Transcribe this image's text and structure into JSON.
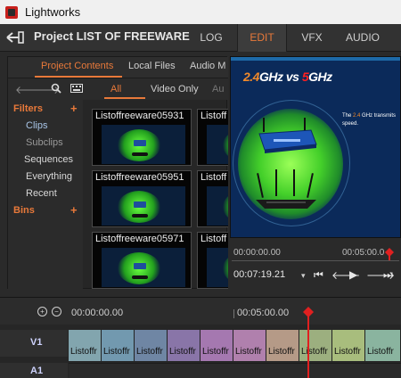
{
  "window": {
    "title": "Lightworks"
  },
  "topbar": {
    "project_title": "Project LIST OF FREEWARE",
    "caret": "▾",
    "tabs": [
      {
        "label": "LOG"
      },
      {
        "label": "EDIT",
        "active": true
      },
      {
        "label": "VFX"
      },
      {
        "label": "AUDIO"
      }
    ]
  },
  "content_panel": {
    "tabs": [
      {
        "label": "Project Contents",
        "active": true
      },
      {
        "label": "Local Files"
      },
      {
        "label": "Audio M"
      }
    ],
    "filter_tabs": [
      {
        "label": "All",
        "active": true
      },
      {
        "label": "Video Only"
      },
      {
        "label": "Au"
      }
    ],
    "filters_heading": "Filters",
    "filters": [
      "Clips",
      "Subclips",
      "Sequences",
      "Everything",
      "Recent"
    ],
    "bins_heading": "Bins",
    "plus": "+",
    "clips": [
      {
        "name": "Listoffreeware05931"
      },
      {
        "name": "Listoff"
      },
      {
        "name": "Listoffreeware05951"
      },
      {
        "name": "Listoff"
      },
      {
        "name": "Listoffreeware05971"
      },
      {
        "name": "Listoff"
      }
    ]
  },
  "viewer": {
    "title_24": "2.4",
    "title_ghz1": "GHz",
    "title_vs": " vs ",
    "title_5": "5",
    "title_ghz2": "GHz",
    "side_text_1": "The ",
    "side_text_24": "2.4",
    "side_text_2": " GHz transmits speed.",
    "tc_start": "00:00:00.00",
    "tc_mid": "00:05:00.0",
    "tc_current": "00:07:19.21",
    "controls": [
      "▾",
      "⏮",
      "🡐",
      "▶",
      "🡒",
      "⏭"
    ]
  },
  "timeline": {
    "ruler_start": "00:00:00.00",
    "ruler_mid": "00:05:00.00",
    "tracks": [
      "V1",
      "A1"
    ],
    "clips": [
      {
        "name": "Listoffr",
        "color": "#7fa6b0"
      },
      {
        "name": "Listoffr",
        "color": "#6e9ab2"
      },
      {
        "name": "Listoffr",
        "color": "#6d86a8"
      },
      {
        "name": "Listoffr",
        "color": "#8a74ad"
      },
      {
        "name": "Listoffr",
        "color": "#a876b5"
      },
      {
        "name": "Listoffr",
        "color": "#b47fb0"
      },
      {
        "name": "Listoffr",
        "color": "#b89a84"
      },
      {
        "name": "Listoffr",
        "color": "#9bb07a"
      },
      {
        "name": "Listoffr",
        "color": "#a7be77"
      },
      {
        "name": "Listoffr",
        "color": "#86b59e"
      }
    ]
  },
  "colors": {
    "accent": "#e8793a",
    "playhead": "#e02020"
  }
}
